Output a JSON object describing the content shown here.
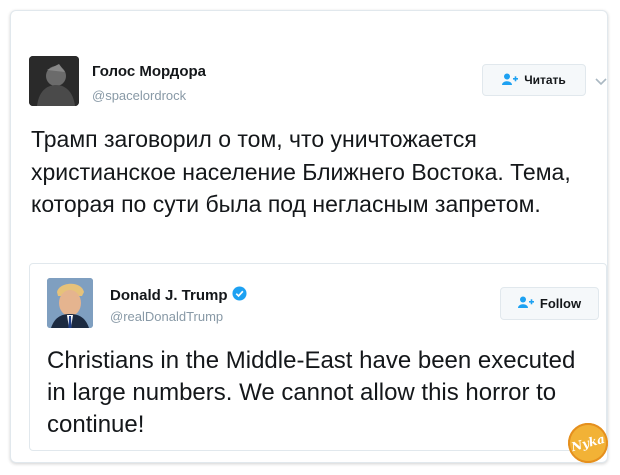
{
  "tweet": {
    "author_name": "Голос Мордора",
    "author_handle": "@spacelordrock",
    "follow_label": "Читать",
    "text": "Трамп заговорил о том, что уничтожается христианское население Ближнего Востока. Тема, которая по сути была под негласным запретом."
  },
  "quoted": {
    "author_name": "Donald J. Trump",
    "author_handle": "@realDonaldTrump",
    "follow_label": "Follow",
    "verified": true,
    "text": "Christians in the Middle-East have been executed in large numbers. We cannot allow this horror to continue!"
  },
  "watermark": {
    "text": "Nyka"
  },
  "icons": {
    "follow": "add-user-icon",
    "verified": "verified-badge-icon",
    "more": "chevron-down-icon"
  },
  "colors": {
    "text": "#14171a",
    "muted": "#8899a6",
    "link": "#1da1f2",
    "border": "#e1e8ed",
    "watermark": "#f2b236"
  }
}
